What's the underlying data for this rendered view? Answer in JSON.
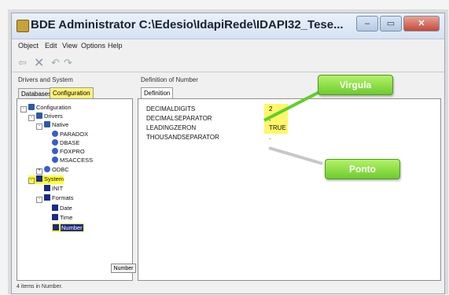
{
  "window": {
    "title": "BDE Administrator  C:\\Edesio\\IdapiRede\\IDAPI32_Tese...",
    "minimize_glyph": "–",
    "maximize_glyph": "▭",
    "close_glyph": "✕"
  },
  "menu": [
    "Object",
    "Edit",
    "View",
    "Options",
    "Help"
  ],
  "toolbar_icons": [
    "back-arrow-icon",
    "delete-icon",
    "undo-icon",
    "redo-icon"
  ],
  "toolbar_glyphs": [
    "⇦",
    "✕",
    "↶",
    "↷"
  ],
  "left_panel": {
    "header": "Drivers and System",
    "tabs": [
      "Databases",
      "Configuration"
    ],
    "active_tab": "Configuration",
    "tree": [
      {
        "label": "Configuration",
        "icon": "cfg",
        "exp": "-"
      },
      {
        "label": "Drivers",
        "icon": "cfg",
        "exp": "-"
      },
      {
        "label": "Native",
        "icon": "cfg",
        "exp": "-"
      },
      {
        "label": "PARADOX",
        "icon": "db",
        "exp": ""
      },
      {
        "label": "DBASE",
        "icon": "db",
        "exp": ""
      },
      {
        "label": "FOXPRO",
        "icon": "db",
        "exp": ""
      },
      {
        "label": "MSACCESS",
        "icon": "db",
        "exp": ""
      },
      {
        "label": "ODBC",
        "icon": "db",
        "exp": "+"
      },
      {
        "label": "System",
        "icon": "pc",
        "exp": "-"
      },
      {
        "label": "INIT",
        "icon": "pc",
        "exp": ""
      },
      {
        "label": "Formats",
        "icon": "pc",
        "exp": "-"
      },
      {
        "label": "Date",
        "icon": "pc",
        "exp": ""
      },
      {
        "label": "Time",
        "icon": "pc",
        "exp": ""
      },
      {
        "label": "Number",
        "icon": "pc",
        "exp": ""
      }
    ],
    "number_button": "Number"
  },
  "right_panel": {
    "header": "Definition of Number",
    "tab": "Definition",
    "params": [
      {
        "name": "DECIMALDIGITS",
        "value": "2"
      },
      {
        "name": "DECIMALSEPARATOR",
        "value": ","
      },
      {
        "name": "LEADINGZERON",
        "value": "TRUE"
      },
      {
        "name": "THOUSANDSEPARATOR",
        "value": "."
      }
    ]
  },
  "callouts": {
    "virgula": "Virgula",
    "ponto": "Ponto"
  },
  "statusbar": "4 items in Number.",
  "colors": {
    "highlight": "#fff44f",
    "callout_green": "#6dcc2e",
    "selection": "#1e2a8a"
  }
}
